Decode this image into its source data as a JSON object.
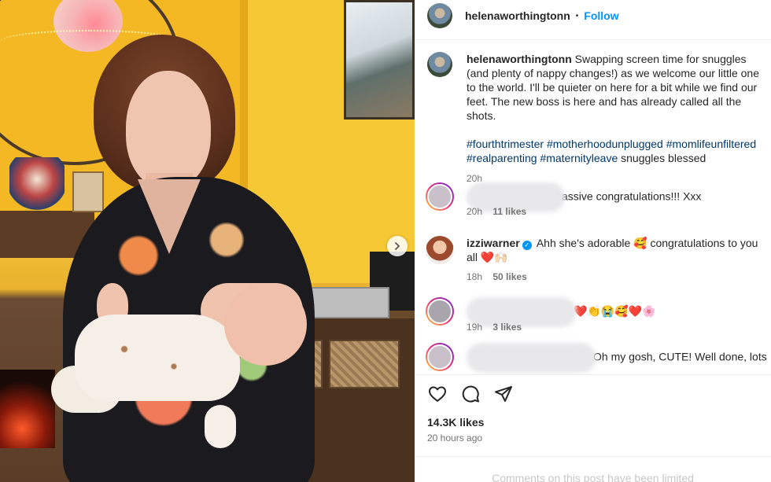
{
  "header": {
    "username": "helenaworthingtonn",
    "separator": "•",
    "follow_label": "Follow"
  },
  "caption": {
    "username": "helenaworthingtonn",
    "text": "Swapping screen time for snuggles (and plenty of nappy changes!) as we welcome our little one to the world. I'll be quieter on here for a bit while we find our feet. The new boss is here and has already called all the shots.",
    "hashtags": [
      "#fourthtrimester",
      "#motherhoodunplugged",
      "#momlifeunfiltered",
      "#realparenting",
      "#maternityleave"
    ],
    "tail_text": "snuggles blessed",
    "time": "20h"
  },
  "comments": [
    {
      "username": "",
      "text": "assive congratulations!!! Xxx",
      "time": "20h",
      "likes": "11 likes",
      "username_blurred": true
    },
    {
      "username": "izziwarner",
      "verified": true,
      "text": "Ahh she's adorable 🥰 congratulations to you all ❤️🙌🏻",
      "time": "18h",
      "likes": "50 likes"
    },
    {
      "username": "",
      "text": "❤️👏😭🥰❤️🌸",
      "time": "19h",
      "likes": "3 likes",
      "username_blurred": true
    },
    {
      "username": "",
      "text": "Oh my gosh, CUTE! Well done, lots of rest",
      "time": "",
      "likes": "",
      "username_blurred": true
    }
  ],
  "actions": {
    "like_icon": "heart-icon",
    "comment_icon": "comment-bubble-icon",
    "share_icon": "paper-plane-icon"
  },
  "likes_count": "14.3K likes",
  "posted_ago": "20 hours ago",
  "comments_limited": "Comments on this post have been limited",
  "colors": {
    "link": "#0095f6",
    "hashtag": "#00376b",
    "muted": "#737373"
  }
}
